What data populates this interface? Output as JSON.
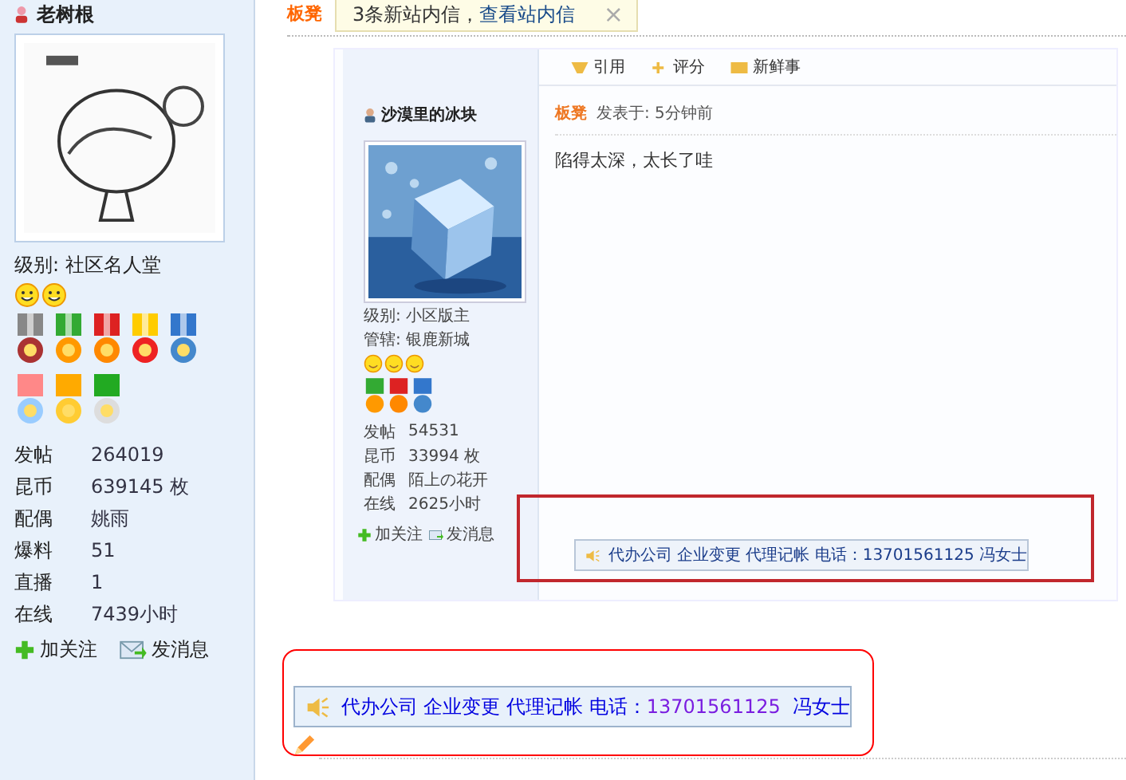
{
  "sidebar": {
    "username": "老树根",
    "level": "级别: 社区名人堂",
    "stats": [
      {
        "label": "发帖",
        "value": "264019"
      },
      {
        "label": "昆币",
        "value": "639145 枚"
      },
      {
        "label": "配偶",
        "value": "姚雨"
      },
      {
        "label": "爆料",
        "value": "51"
      },
      {
        "label": "直播",
        "value": "1"
      },
      {
        "label": "在线",
        "value": "7439小时"
      }
    ],
    "actions": [
      {
        "kind": "follow",
        "label": "加关注"
      },
      {
        "kind": "message",
        "label": "发消息"
      }
    ]
  },
  "post": {
    "floor": "板凳"
  },
  "notice": {
    "text": "3条新站内信，",
    "link": "查看站内信",
    "close": "×"
  },
  "embedded_screenshot": {
    "toolbar": [
      {
        "kind": "quote",
        "label": "引用"
      },
      {
        "kind": "rate",
        "label": "评分"
      },
      {
        "kind": "news",
        "label": "新鲜事"
      }
    ],
    "author": "沙漠里的冰块",
    "level": "级别: 小区版主",
    "manages": "管辖: 银鹿新城",
    "stats": [
      {
        "label": "发帖",
        "value": "54531"
      },
      {
        "label": "昆币",
        "value": "33994 枚"
      },
      {
        "label": "配偶",
        "value": "陌上の花开"
      },
      {
        "label": "在线",
        "value": "2625小时"
      }
    ],
    "actions": [
      {
        "kind": "follow",
        "label": "加关注"
      },
      {
        "kind": "message",
        "label": "发消息"
      }
    ],
    "floor": "板凳",
    "posted": "发表于: 5分钟前",
    "message": "陷得太深，太长了哇",
    "ad": "代办公司 企业变更 代理记帐 电话：13701561125  冯女士"
  },
  "ad": {
    "text": "代办公司 企业变更 代理记帐 电话：",
    "phone": "13701561125",
    "contact": "冯女士"
  }
}
